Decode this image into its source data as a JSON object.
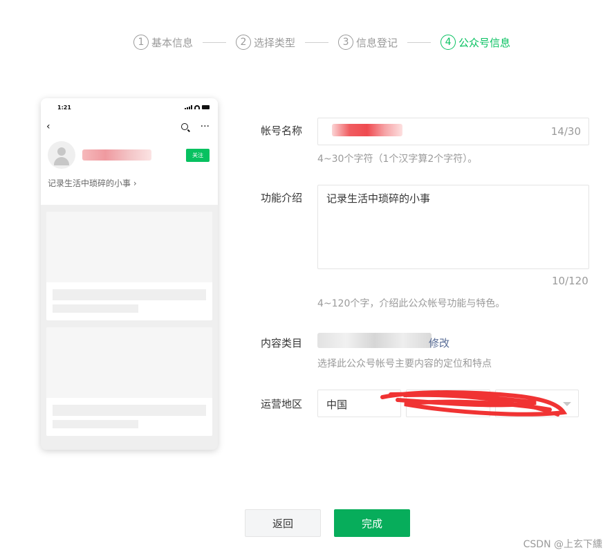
{
  "steps": [
    {
      "num": "1",
      "label": "基本信息"
    },
    {
      "num": "2",
      "label": "选择类型"
    },
    {
      "num": "3",
      "label": "信息登记"
    },
    {
      "num": "4",
      "label": "公众号信息",
      "active": true
    }
  ],
  "preview": {
    "time": "1:21",
    "back_icon": "chevron-left-icon",
    "follow_label": "关注",
    "intro": "记录生活中琐碎的小事 ›"
  },
  "form": {
    "name_label": "帐号名称",
    "name_counter": "14/30",
    "name_hint": "4~30个字符（1个汉字算2个字符）。",
    "desc_label": "功能介绍",
    "desc_value": "记录生活中琐碎的小事",
    "desc_counter": "10/120",
    "desc_hint": "4~120个字，介绍此公众帐号功能与特色。",
    "category_label": "内容类目",
    "category_modify": "修改",
    "category_hint": "选择此公众号帐号主要内容的定位和特点",
    "region_label": "运营地区",
    "region_country": "中国"
  },
  "buttons": {
    "back": "返回",
    "done": "完成"
  },
  "watermark": "CSDN @上玄下纁",
  "colors": {
    "accent": "#07c160",
    "link": "#576b95"
  }
}
